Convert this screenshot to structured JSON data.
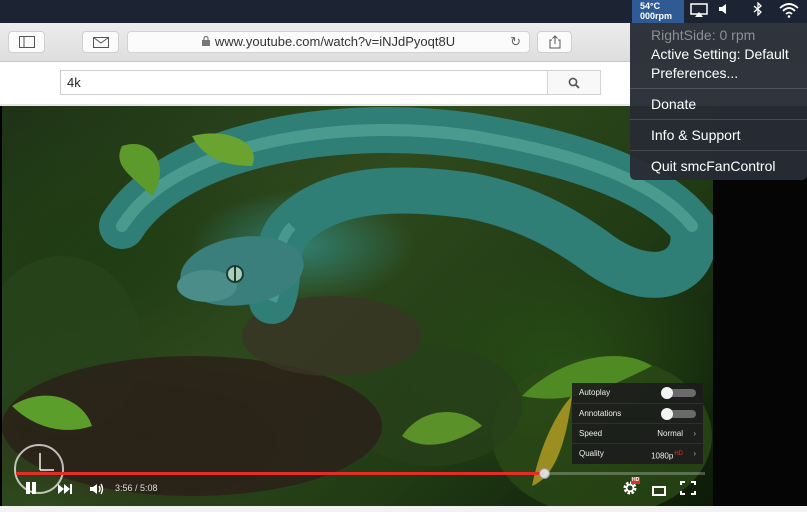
{
  "menubar": {
    "temperature": "54°C",
    "fan_speed": "000rpm",
    "icons": [
      "airplay-icon",
      "volume-icon",
      "bluetooth-icon",
      "wifi-icon"
    ]
  },
  "browser": {
    "url": "www.youtube.com/watch?v=iNJdPyoqt8U",
    "icons": [
      "sidebar-icon",
      "mail-icon",
      "lock-icon",
      "reload-icon",
      "share-icon"
    ]
  },
  "search": {
    "value": "4k",
    "icon": "search-icon"
  },
  "player": {
    "current_time": "3:56",
    "duration": "5:08",
    "progress_played": 0.766,
    "icons": [
      "pause-icon",
      "next-icon",
      "volume-icon",
      "settings-icon",
      "theater-icon",
      "fullscreen-icon"
    ],
    "settings_badge": "HD",
    "accent_color": "#e52d27",
    "settings_panel": {
      "autoplay_label": "Autoplay",
      "autoplay_on": false,
      "annotations_label": "Annotations",
      "annotations_on": false,
      "speed_label": "Speed",
      "speed_value": "Normal",
      "quality_label": "Quality",
      "quality_value": "1080p",
      "quality_badge": "HD"
    }
  },
  "menu": {
    "fan_status": "RightSide: 0 rpm",
    "active_setting": "Active Setting: Default",
    "preferences": "Preferences...",
    "donate": "Donate",
    "info": "Info & Support",
    "quit": "Quit smcFanControl"
  }
}
